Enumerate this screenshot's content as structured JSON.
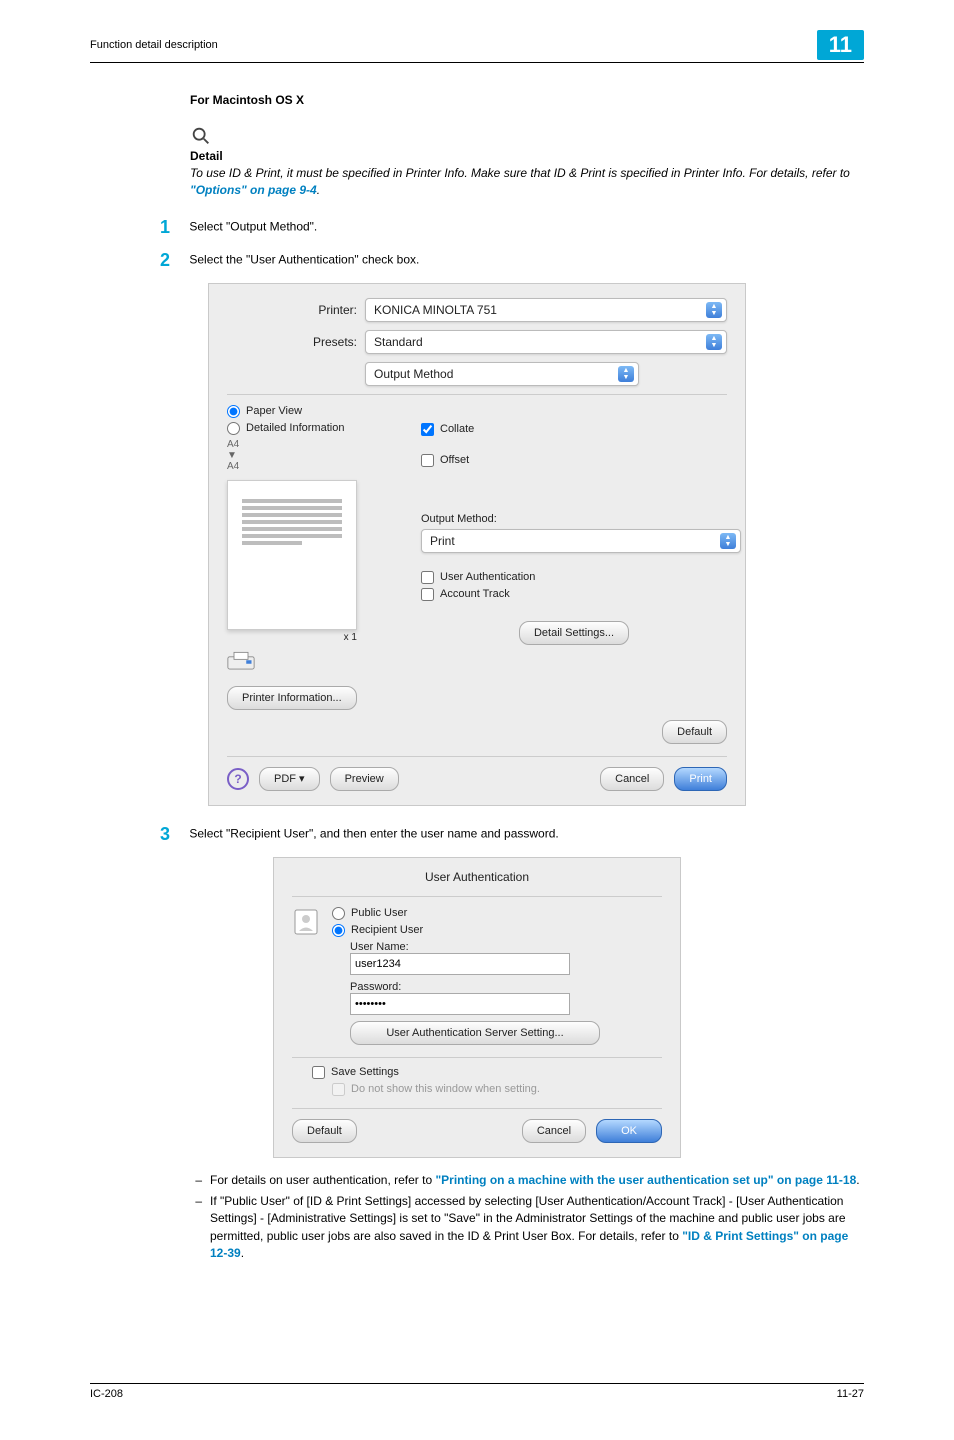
{
  "header": {
    "section": "Function detail description",
    "chapter": "11"
  },
  "subhead": "For Macintosh OS X",
  "detail": {
    "title": "Detail",
    "body_pre": "To use ID & Print, it must be specified in Printer Info. Make sure that ID & Print is specified in Printer Info. For details, refer to ",
    "link": "\"Options\" on page 9-4",
    "body_post": "."
  },
  "steps": {
    "s1": {
      "num": "1",
      "text": "Select \"Output Method\"."
    },
    "s2": {
      "num": "2",
      "text": "Select the \"User Authentication\" check box."
    },
    "s3": {
      "num": "3",
      "text": "Select \"Recipient User\", and then enter the user name and password."
    }
  },
  "dlg1": {
    "printer_label": "Printer:",
    "printer_value": "KONICA MINOLTA 751",
    "presets_label": "Presets:",
    "presets_value": "Standard",
    "section_value": "Output Method",
    "radio_paper": "Paper View",
    "radio_detailed": "Detailed Information",
    "meta1": "A4",
    "meta2": "▼",
    "meta3": "A4",
    "xcount": "x 1",
    "collate": "Collate",
    "offset": "Offset",
    "om_head": "Output Method:",
    "om_value": "Print",
    "ua": "User Authentication",
    "at": "Account Track",
    "pinfo": "Printer Information...",
    "dset": "Detail Settings...",
    "def": "Default",
    "pdf": "PDF ▾",
    "prev": "Preview",
    "cancel": "Cancel",
    "print": "Print"
  },
  "dlg2": {
    "title": "User Authentication",
    "public": "Public User",
    "recipient": "Recipient User",
    "uname_label": "User Name:",
    "uname_value": "user1234",
    "pwd_label": "Password:",
    "pwd_value": "••••••••",
    "uass": "User Authentication Server Setting...",
    "save": "Save Settings",
    "noshow": "Do not show this window when setting.",
    "def": "Default",
    "cancel": "Cancel",
    "ok": "OK"
  },
  "post": {
    "p1_pre": "For details on user authentication, refer to ",
    "p1_link": "\"Printing on a machine with the user authentication set up\" on page 11-18",
    "p1_post": ".",
    "p2_pre": "If \"Public User\" of [ID & Print Settings] accessed by selecting [User Authentication/Account Track] - [User Authentication Settings] - [Administrative Settings] is set to \"Save\" in the Administrator Settings of the machine and public user jobs are permitted, public user jobs are also saved in the ID & Print User Box. For details, refer to ",
    "p2_link": "\"ID & Print Settings\" on page 12-39",
    "p2_post": "."
  },
  "footer": {
    "left": "IC-208",
    "right": "11-27"
  }
}
